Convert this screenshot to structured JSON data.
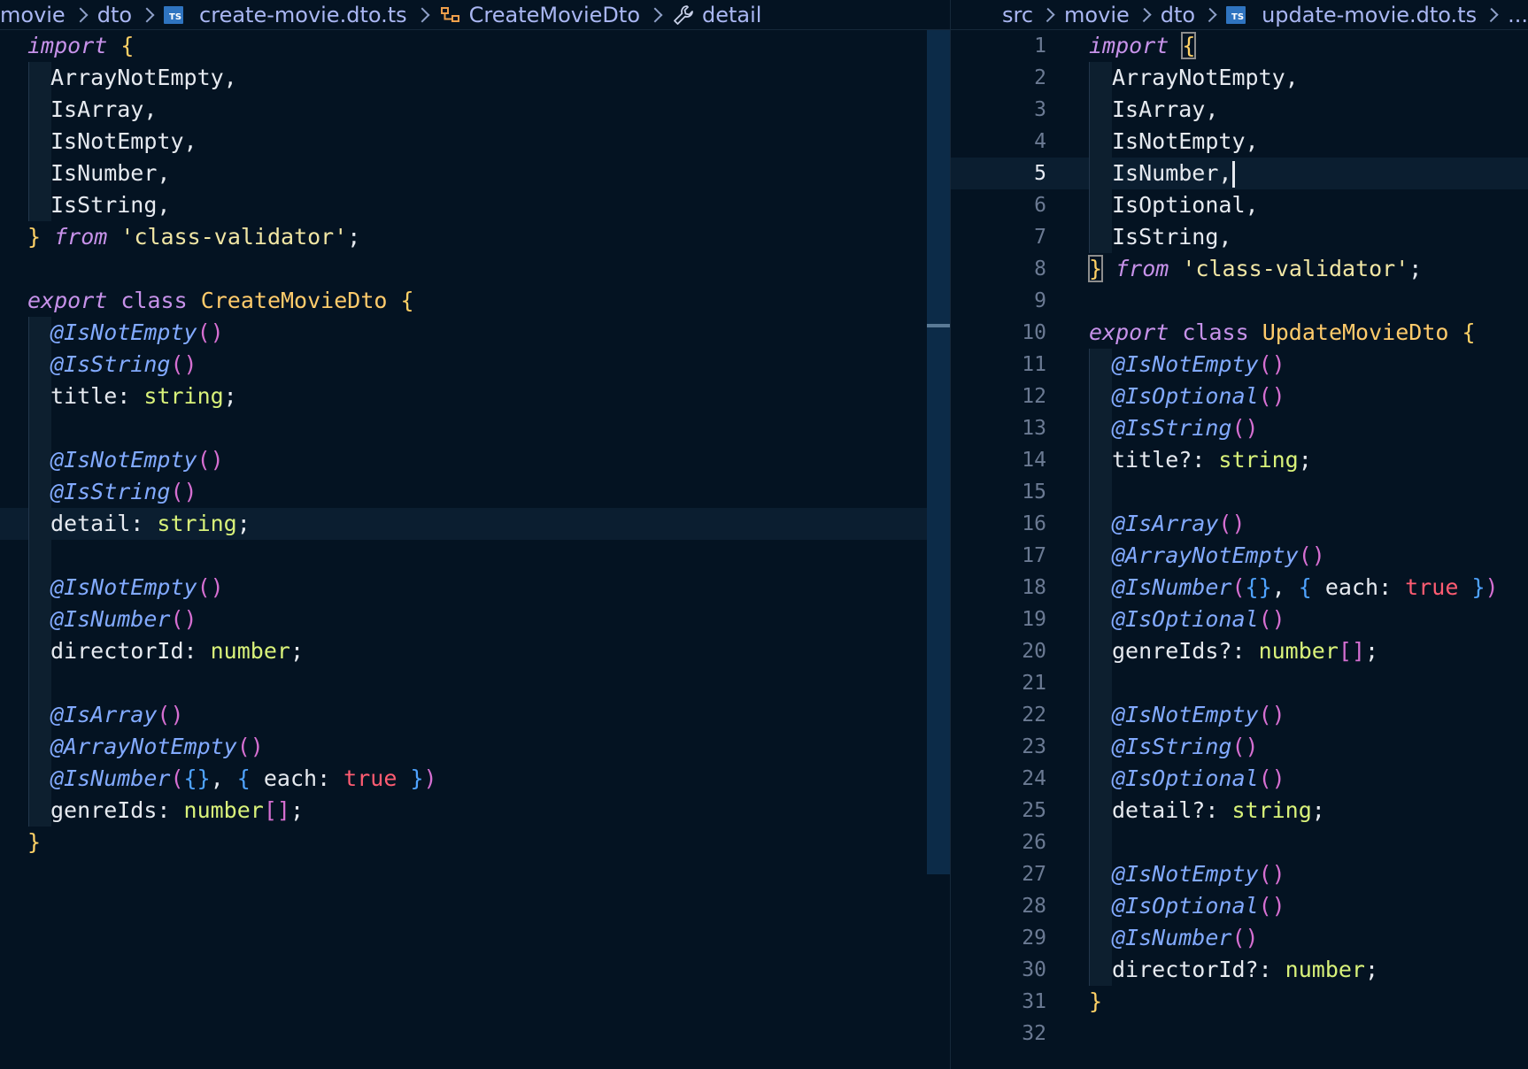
{
  "left_editor": {
    "breadcrumb": [
      "movie",
      "dto",
      "create-movie.dto.ts",
      "CreateMovieDto",
      "detail"
    ],
    "ts_badge": "TS",
    "lines": [
      {
        "indent": false,
        "t": [
          [
            "kw-i",
            "import"
          ],
          [
            "pn",
            " "
          ],
          [
            "br-y",
            "{"
          ]
        ]
      },
      {
        "indent": true,
        "t": [
          [
            "pn",
            "ArrayNotEmpty,"
          ]
        ]
      },
      {
        "indent": true,
        "t": [
          [
            "pn",
            "IsArray,"
          ]
        ]
      },
      {
        "indent": true,
        "t": [
          [
            "pn",
            "IsNotEmpty,"
          ]
        ]
      },
      {
        "indent": true,
        "t": [
          [
            "pn",
            "IsNumber,"
          ]
        ]
      },
      {
        "indent": true,
        "t": [
          [
            "pn",
            "IsString,"
          ]
        ]
      },
      {
        "indent": false,
        "t": [
          [
            "br-y",
            "}"
          ],
          [
            "pn",
            " "
          ],
          [
            "kw-i",
            "from"
          ],
          [
            "pn",
            " "
          ],
          [
            "str",
            "'class-validator'"
          ],
          [
            "pn",
            ";"
          ]
        ]
      },
      {
        "indent": false,
        "t": []
      },
      {
        "indent": false,
        "t": [
          [
            "kw-i",
            "export"
          ],
          [
            "pn",
            " "
          ],
          [
            "kw",
            "class"
          ],
          [
            "pn",
            " "
          ],
          [
            "cls",
            "CreateMovieDto"
          ],
          [
            "pn",
            " "
          ],
          [
            "br-y",
            "{"
          ]
        ]
      },
      {
        "indent": true,
        "t": [
          [
            "dec",
            "@IsNotEmpty"
          ],
          [
            "par",
            "()"
          ]
        ]
      },
      {
        "indent": true,
        "t": [
          [
            "dec",
            "@IsString"
          ],
          [
            "par",
            "()"
          ]
        ]
      },
      {
        "indent": true,
        "t": [
          [
            "pn",
            "title: "
          ],
          [
            "typ",
            "string"
          ],
          [
            "pn",
            ";"
          ]
        ]
      },
      {
        "indent": true,
        "t": []
      },
      {
        "indent": true,
        "t": [
          [
            "dec",
            "@IsNotEmpty"
          ],
          [
            "par",
            "()"
          ]
        ]
      },
      {
        "indent": true,
        "t": [
          [
            "dec",
            "@IsString"
          ],
          [
            "par",
            "()"
          ]
        ]
      },
      {
        "indent": true,
        "current": true,
        "t": [
          [
            "pn",
            "detail: "
          ],
          [
            "typ",
            "string"
          ],
          [
            "pn",
            ";"
          ]
        ]
      },
      {
        "indent": true,
        "t": []
      },
      {
        "indent": true,
        "t": [
          [
            "dec",
            "@IsNotEmpty"
          ],
          [
            "par",
            "()"
          ]
        ]
      },
      {
        "indent": true,
        "t": [
          [
            "dec",
            "@IsNumber"
          ],
          [
            "par",
            "()"
          ]
        ]
      },
      {
        "indent": true,
        "t": [
          [
            "pn",
            "directorId: "
          ],
          [
            "typ",
            "number"
          ],
          [
            "pn",
            ";"
          ]
        ]
      },
      {
        "indent": true,
        "t": []
      },
      {
        "indent": true,
        "t": [
          [
            "dec",
            "@IsArray"
          ],
          [
            "par",
            "()"
          ]
        ]
      },
      {
        "indent": true,
        "t": [
          [
            "dec",
            "@ArrayNotEmpty"
          ],
          [
            "par",
            "()"
          ]
        ]
      },
      {
        "indent": true,
        "t": [
          [
            "dec",
            "@IsNumber"
          ],
          [
            "par",
            "("
          ],
          [
            "br-b",
            "{}"
          ],
          [
            "pn",
            ", "
          ],
          [
            "br-b",
            "{"
          ],
          [
            "pn",
            " each: "
          ],
          [
            "bool",
            "true"
          ],
          [
            "pn",
            " "
          ],
          [
            "br-b",
            "}"
          ],
          [
            "par",
            ")"
          ]
        ]
      },
      {
        "indent": true,
        "t": [
          [
            "pn",
            "genreIds: "
          ],
          [
            "typ",
            "number"
          ],
          [
            "par",
            "[]"
          ],
          [
            "pn",
            ";"
          ]
        ]
      },
      {
        "indent": false,
        "t": [
          [
            "br-y",
            "}"
          ]
        ]
      }
    ]
  },
  "right_editor": {
    "breadcrumb": [
      "src",
      "movie",
      "dto",
      "update-movie.dto.ts",
      "..."
    ],
    "ts_badge": "TS",
    "active_line": 5,
    "lines": [
      {
        "n": "1",
        "indent": false,
        "t": [
          [
            "kw-i",
            "import"
          ],
          [
            "pn",
            " "
          ],
          [
            "br-y hl",
            "{"
          ]
        ]
      },
      {
        "n": "2",
        "indent": true,
        "t": [
          [
            "pn",
            "ArrayNotEmpty,"
          ]
        ]
      },
      {
        "n": "3",
        "indent": true,
        "t": [
          [
            "pn",
            "IsArray,"
          ]
        ]
      },
      {
        "n": "4",
        "indent": true,
        "t": [
          [
            "pn",
            "IsNotEmpty,"
          ]
        ]
      },
      {
        "n": "5",
        "indent": true,
        "current": true,
        "cursor": true,
        "t": [
          [
            "pn",
            "IsNumber,"
          ]
        ]
      },
      {
        "n": "6",
        "indent": true,
        "t": [
          [
            "pn",
            "IsOptional,"
          ]
        ]
      },
      {
        "n": "7",
        "indent": true,
        "t": [
          [
            "pn",
            "IsString,"
          ]
        ]
      },
      {
        "n": "8",
        "indent": false,
        "t": [
          [
            "br-y hl",
            "}"
          ],
          [
            "pn",
            " "
          ],
          [
            "kw-i",
            "from"
          ],
          [
            "pn",
            " "
          ],
          [
            "str",
            "'class-validator'"
          ],
          [
            "pn",
            ";"
          ]
        ]
      },
      {
        "n": "9",
        "indent": false,
        "t": []
      },
      {
        "n": "10",
        "indent": false,
        "t": [
          [
            "kw-i",
            "export"
          ],
          [
            "pn",
            " "
          ],
          [
            "kw",
            "class"
          ],
          [
            "pn",
            " "
          ],
          [
            "cls",
            "UpdateMovieDto"
          ],
          [
            "pn",
            " "
          ],
          [
            "br-y",
            "{"
          ]
        ]
      },
      {
        "n": "11",
        "indent": true,
        "t": [
          [
            "dec",
            "@IsNotEmpty"
          ],
          [
            "par",
            "()"
          ]
        ]
      },
      {
        "n": "12",
        "indent": true,
        "t": [
          [
            "dec",
            "@IsOptional"
          ],
          [
            "par",
            "()"
          ]
        ]
      },
      {
        "n": "13",
        "indent": true,
        "t": [
          [
            "dec",
            "@IsString"
          ],
          [
            "par",
            "()"
          ]
        ]
      },
      {
        "n": "14",
        "indent": true,
        "t": [
          [
            "pn",
            "title?: "
          ],
          [
            "typ",
            "string"
          ],
          [
            "pn",
            ";"
          ]
        ]
      },
      {
        "n": "15",
        "indent": true,
        "t": []
      },
      {
        "n": "16",
        "indent": true,
        "t": [
          [
            "dec",
            "@IsArray"
          ],
          [
            "par",
            "()"
          ]
        ]
      },
      {
        "n": "17",
        "indent": true,
        "t": [
          [
            "dec",
            "@ArrayNotEmpty"
          ],
          [
            "par",
            "()"
          ]
        ]
      },
      {
        "n": "18",
        "indent": true,
        "t": [
          [
            "dec",
            "@IsNumber"
          ],
          [
            "par",
            "("
          ],
          [
            "br-b",
            "{}"
          ],
          [
            "pn",
            ", "
          ],
          [
            "br-b",
            "{"
          ],
          [
            "pn",
            " each: "
          ],
          [
            "bool",
            "true"
          ],
          [
            "pn",
            " "
          ],
          [
            "br-b",
            "}"
          ],
          [
            "par",
            ")"
          ]
        ]
      },
      {
        "n": "19",
        "indent": true,
        "t": [
          [
            "dec",
            "@IsOptional"
          ],
          [
            "par",
            "()"
          ]
        ]
      },
      {
        "n": "20",
        "indent": true,
        "t": [
          [
            "pn",
            "genreIds?: "
          ],
          [
            "typ",
            "number"
          ],
          [
            "par",
            "[]"
          ],
          [
            "pn",
            ";"
          ]
        ]
      },
      {
        "n": "21",
        "indent": true,
        "t": []
      },
      {
        "n": "22",
        "indent": true,
        "t": [
          [
            "dec",
            "@IsNotEmpty"
          ],
          [
            "par",
            "()"
          ]
        ]
      },
      {
        "n": "23",
        "indent": true,
        "t": [
          [
            "dec",
            "@IsString"
          ],
          [
            "par",
            "()"
          ]
        ]
      },
      {
        "n": "24",
        "indent": true,
        "t": [
          [
            "dec",
            "@IsOptional"
          ],
          [
            "par",
            "()"
          ]
        ]
      },
      {
        "n": "25",
        "indent": true,
        "t": [
          [
            "pn",
            "detail?: "
          ],
          [
            "typ",
            "string"
          ],
          [
            "pn",
            ";"
          ]
        ]
      },
      {
        "n": "26",
        "indent": true,
        "t": []
      },
      {
        "n": "27",
        "indent": true,
        "t": [
          [
            "dec",
            "@IsNotEmpty"
          ],
          [
            "par",
            "()"
          ]
        ]
      },
      {
        "n": "28",
        "indent": true,
        "t": [
          [
            "dec",
            "@IsOptional"
          ],
          [
            "par",
            "()"
          ]
        ]
      },
      {
        "n": "29",
        "indent": true,
        "t": [
          [
            "dec",
            "@IsNumber"
          ],
          [
            "par",
            "()"
          ]
        ]
      },
      {
        "n": "30",
        "indent": true,
        "t": [
          [
            "pn",
            "directorId?: "
          ],
          [
            "typ",
            "number"
          ],
          [
            "pn",
            ";"
          ]
        ]
      },
      {
        "n": "31",
        "indent": false,
        "t": [
          [
            "br-y",
            "}"
          ]
        ]
      },
      {
        "n": "32",
        "indent": false,
        "t": []
      }
    ]
  }
}
